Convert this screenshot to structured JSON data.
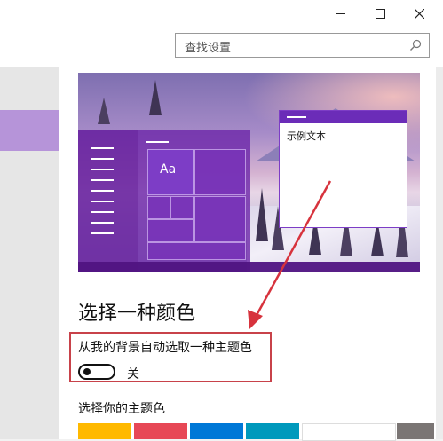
{
  "window": {
    "buttons": {
      "minimize": "minimize",
      "maximize": "maximize",
      "close": "close"
    }
  },
  "search": {
    "placeholder": "查找设置",
    "icon": "search-icon"
  },
  "preview": {
    "tile_text": "Aa",
    "sample_window_text": "示例文本"
  },
  "colors_section": {
    "title": "选择一种颜色",
    "auto_pick_label": "从我的背景自动选取一种主题色",
    "toggle": {
      "state": "关",
      "on": false
    },
    "accent_label": "选择你的主题色",
    "accent_swatches": [
      "#ffb900",
      "#e74856",
      "#0078d7",
      "#0099bc",
      "#ffffff",
      "#7a7574"
    ]
  },
  "theme": {
    "accent": "#7d3dc6",
    "highlight": "#c8424a",
    "nav_selected": "#b694d9"
  }
}
